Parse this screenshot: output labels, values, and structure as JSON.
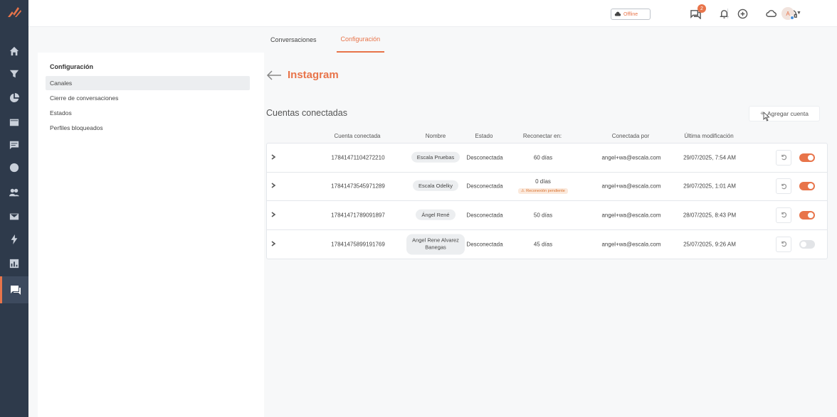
{
  "sidebar": {
    "icons": [
      "logo-icon",
      "home-icon",
      "filter-icon",
      "pie-chart-icon",
      "inbox-icon",
      "message-icon",
      "analytics-icon",
      "contacts-icon",
      "mail-icon",
      "bolt-icon",
      "report-icon",
      "chat-icon"
    ],
    "active": "chat-icon"
  },
  "topbar": {
    "offline_label": "Offline",
    "notification_count": "2",
    "avatar_initial": "A"
  },
  "tabs": [
    {
      "label": "Conversaciones",
      "active": false
    },
    {
      "label": "Configuración",
      "active": true
    }
  ],
  "config": {
    "title": "Configuración",
    "items": [
      {
        "label": "Canales",
        "active": true
      },
      {
        "label": "Cierre de conversaciones",
        "active": false
      },
      {
        "label": "Estados",
        "active": false
      },
      {
        "label": "Perfiles bloqueados",
        "active": false
      }
    ]
  },
  "main": {
    "title": "Instagram",
    "section_title": "Cuentas conectadas",
    "add_button": "Agregar cuenta",
    "columns": [
      "Cuenta conectada",
      "Nombre",
      "Estado",
      "Reconectar en:",
      "Conectada por",
      "Última modificación"
    ],
    "rows": [
      {
        "account": "17841471104272210",
        "name": "Escala Pruebas",
        "status": "Desconectada",
        "reconnect": "60 días",
        "warning": "",
        "connected_by": "angel+wa@escala.com",
        "modified": "29/07/2025, 7:54 AM",
        "enabled": true
      },
      {
        "account": "17841473545971289",
        "name": "Escala Odelky",
        "status": "Desconectada",
        "reconnect": "0 días",
        "warning": "Reconexión pendiente",
        "connected_by": "angel+wa@escala.com",
        "modified": "29/07/2025, 1:01 AM",
        "enabled": true
      },
      {
        "account": "17841471789091897",
        "name": "Ángel René",
        "status": "Desconectada",
        "reconnect": "50 días",
        "warning": "",
        "connected_by": "angel+wa@escala.com",
        "modified": "28/07/2025, 8:43 PM",
        "enabled": true
      },
      {
        "account": "17841475899191769",
        "name": "Angel Rene Alvarez Banegas",
        "status": "Desconectada",
        "reconnect": "45 días",
        "warning": "",
        "connected_by": "angel+wa@escala.com",
        "modified": "25/07/2025, 9:26 AM",
        "enabled": false
      }
    ]
  },
  "colors": {
    "accent": "#e8744a",
    "sidebar_bg": "#2e3a4b"
  }
}
